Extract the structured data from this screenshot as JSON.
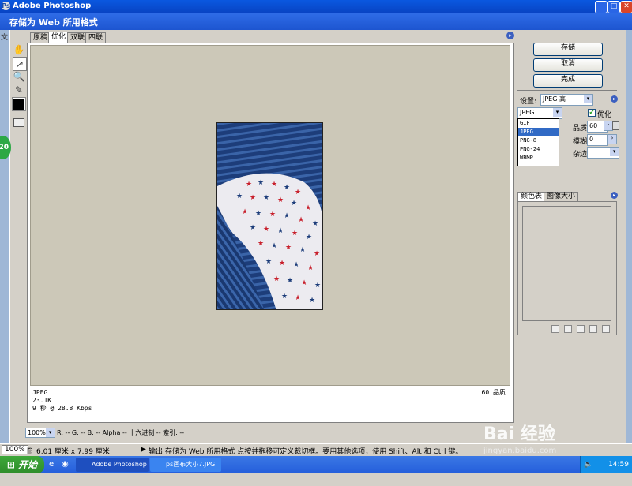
{
  "app": {
    "title": "Adobe Photoshop",
    "menu_fragment": "文"
  },
  "dialog": {
    "title": "存储为 Web 所用格式"
  },
  "tabs": [
    {
      "label": "原稿",
      "active": false
    },
    {
      "label": "优化",
      "active": true
    },
    {
      "label": "双联",
      "active": false
    },
    {
      "label": "四联",
      "active": false
    }
  ],
  "badge": {
    "text": "20"
  },
  "buttons": {
    "save": "存储",
    "cancel": "取消",
    "done": "完成"
  },
  "settings": {
    "label": "设置:",
    "preset": "JPEG 高"
  },
  "format": {
    "selected": "JPEG",
    "options": [
      "GIF",
      "JPEG",
      "PNG-8",
      "PNG-24",
      "WBMP"
    ]
  },
  "optimize": {
    "label": "优化",
    "checked": true
  },
  "quality": {
    "label": "品质:",
    "value": "60"
  },
  "blur": {
    "label": "模糊:",
    "value": "0"
  },
  "matte": {
    "label": "杂边:",
    "value": ""
  },
  "panel_tabs": {
    "color_table": "颜色表",
    "image_size": "图像大小"
  },
  "info": {
    "format": "JPEG",
    "size": "23.1K",
    "time": "9 秒 @ 28.8 Kbps",
    "quality": "60 品质"
  },
  "status": {
    "zoom": "100%",
    "color_readout": "R: -- G: -- B: -- Alpha -- 十六进制       -- 索引: --"
  },
  "app_status": {
    "zoom": "100%",
    "doc_size": "6.01 厘米 x 7.99 厘米",
    "hint": "输出:存储为 Web 所用格式  点按并拖移可定义裁切框。要用其他选项，使用 Shift、Alt 和 Ctrl 键。"
  },
  "taskbar": {
    "start": "开始",
    "tasks": [
      "Adobe Photoshop",
      "ps画布大小7.JPG ..."
    ],
    "clock": "14:59"
  },
  "watermark": {
    "text": "Bai 经验",
    "url": "jingyan.baidu.com"
  }
}
